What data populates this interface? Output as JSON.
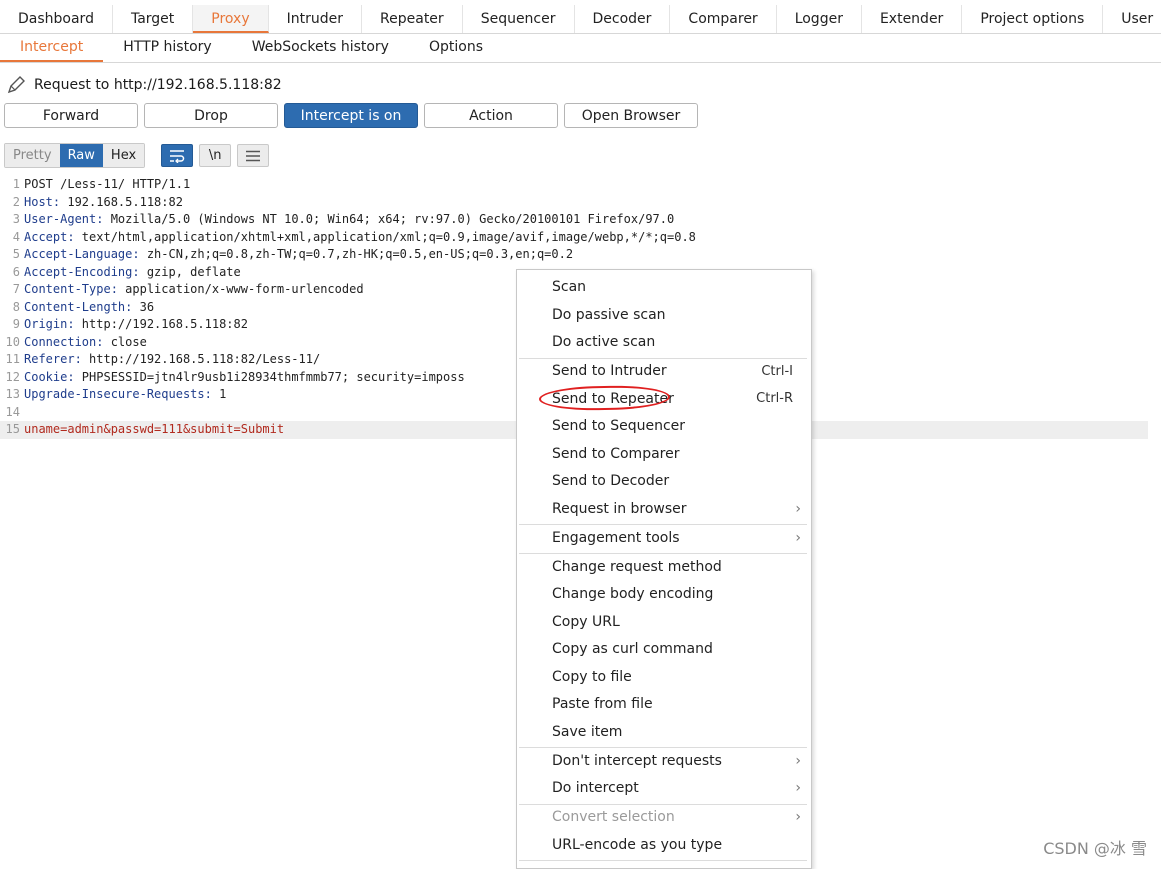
{
  "main_tabs": [
    "Dashboard",
    "Target",
    "Proxy",
    "Intruder",
    "Repeater",
    "Sequencer",
    "Decoder",
    "Comparer",
    "Logger",
    "Extender",
    "Project options",
    "User"
  ],
  "active_main_tab": "Proxy",
  "sub_tabs": [
    "Intercept",
    "HTTP history",
    "WebSockets history",
    "Options"
  ],
  "request_label": "Request to http://192.168.5.118:82",
  "buttons": {
    "forward": "Forward",
    "drop": "Drop",
    "intercept": "Intercept is on",
    "action": "Action",
    "open_browser": "Open Browser"
  },
  "view_modes": [
    "Pretty",
    "Raw",
    "Hex"
  ],
  "newline_toggle": "\\n",
  "request_lines": [
    {
      "n": "1",
      "key": "",
      "val": "POST /Less-11/ HTTP/1.1"
    },
    {
      "n": "2",
      "key": "Host:",
      "val": " 192.168.5.118:82"
    },
    {
      "n": "3",
      "key": "User-Agent:",
      "val": " Mozilla/5.0 (Windows NT 10.0; Win64; x64; rv:97.0) Gecko/20100101 Firefox/97.0"
    },
    {
      "n": "4",
      "key": "Accept:",
      "val": " text/html,application/xhtml+xml,application/xml;q=0.9,image/avif,image/webp,*/*;q=0.8"
    },
    {
      "n": "5",
      "key": "Accept-Language:",
      "val": " zh-CN,zh;q=0.8,zh-TW;q=0.7,zh-HK;q=0.5,en-US;q=0.3,en;q=0.2"
    },
    {
      "n": "6",
      "key": "Accept-Encoding:",
      "val": " gzip, deflate"
    },
    {
      "n": "7",
      "key": "Content-Type:",
      "val": " application/x-www-form-urlencoded"
    },
    {
      "n": "8",
      "key": "Content-Length:",
      "val": " 36"
    },
    {
      "n": "9",
      "key": "Origin:",
      "val": " http://192.168.5.118:82"
    },
    {
      "n": "10",
      "key": "Connection:",
      "val": " close"
    },
    {
      "n": "11",
      "key": "Referer:",
      "val": " http://192.168.5.118:82/Less-11/"
    },
    {
      "n": "12",
      "key": "Cookie:",
      "val": " PHPSESSID=jtn4lr9usb1i28934thmfmmb77; security=imposs"
    },
    {
      "n": "13",
      "key": "Upgrade-Insecure-Requests:",
      "val": " 1"
    },
    {
      "n": "14",
      "key": "",
      "val": ""
    },
    {
      "n": "15",
      "key": "",
      "val": "uname=admin&passwd=111&submit=Submit"
    }
  ],
  "context_menu": [
    {
      "label": "Scan"
    },
    {
      "label": "Do passive scan"
    },
    {
      "label": "Do active scan",
      "sep_after": true
    },
    {
      "label": "Send to Intruder",
      "shortcut": "Ctrl-I"
    },
    {
      "label": "Send to Repeater",
      "shortcut": "Ctrl-R",
      "highlighted": true
    },
    {
      "label": "Send to Sequencer"
    },
    {
      "label": "Send to Comparer"
    },
    {
      "label": "Send to Decoder"
    },
    {
      "label": "Request in browser",
      "submenu": true,
      "sep_after": true
    },
    {
      "label": "Engagement tools",
      "submenu": true,
      "sep_after": true
    },
    {
      "label": "Change request method"
    },
    {
      "label": "Change body encoding"
    },
    {
      "label": "Copy URL"
    },
    {
      "label": "Copy as curl command"
    },
    {
      "label": "Copy to file"
    },
    {
      "label": "Paste from file"
    },
    {
      "label": "Save item",
      "sep_after": true
    },
    {
      "label": "Don't intercept requests",
      "submenu": true
    },
    {
      "label": "Do intercept",
      "submenu": true,
      "sep_after": true
    },
    {
      "label": "Convert selection",
      "submenu": true,
      "disabled": true
    },
    {
      "label": "URL-encode as you type",
      "sep_after": true
    }
  ],
  "watermark": "CSDN @冰 雪",
  "colors": {
    "accent": "#e8773a",
    "primary": "#2d6cb0",
    "header_key": "#1f3d8c",
    "param_value": "#b12a1e",
    "annotation": "#e02020"
  }
}
